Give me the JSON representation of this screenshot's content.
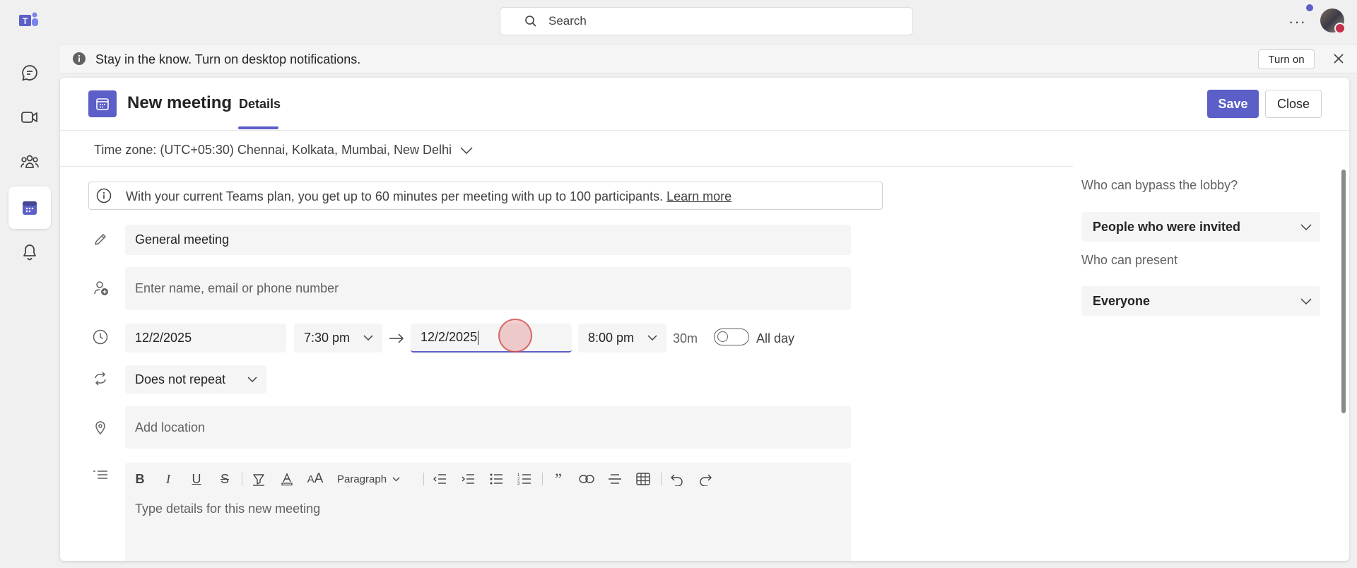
{
  "search": {
    "placeholder": "Search"
  },
  "rail": {
    "items": [
      "chat",
      "meet",
      "communities",
      "calendar",
      "activity"
    ]
  },
  "banner": {
    "text": "Stay in the know. Turn on desktop notifications.",
    "action": "Turn on"
  },
  "header": {
    "title": "New meeting",
    "tab": "Details",
    "save": "Save",
    "close": "Close"
  },
  "timezone": {
    "label": "Time zone: (UTC+05:30) Chennai, Kolkata, Mumbai, New Delhi"
  },
  "info": {
    "text": "With your current Teams plan, you get up to 60 minutes per meeting with up to 100 participants.",
    "link": "Learn more"
  },
  "form": {
    "title_value": "General meeting",
    "attendees_placeholder": "Enter name, email or phone number",
    "start_date": "12/2/2025",
    "start_time": "7:30 pm",
    "end_date": "12/2/2025",
    "end_time": "8:00 pm",
    "duration": "30m",
    "all_day_label": "All day",
    "all_day_on": false,
    "repeat": "Does not repeat",
    "location_placeholder": "Add location",
    "details_placeholder": "Type details for this new meeting",
    "paragraph_style": "Paragraph"
  },
  "options": {
    "bypass_label": "Who can bypass the lobby?",
    "bypass_value": "People who were invited",
    "present_label": "Who can present",
    "present_value": "Everyone"
  },
  "colors": {
    "accent": "#5b5fc7",
    "field_bg": "#f5f5f5"
  }
}
